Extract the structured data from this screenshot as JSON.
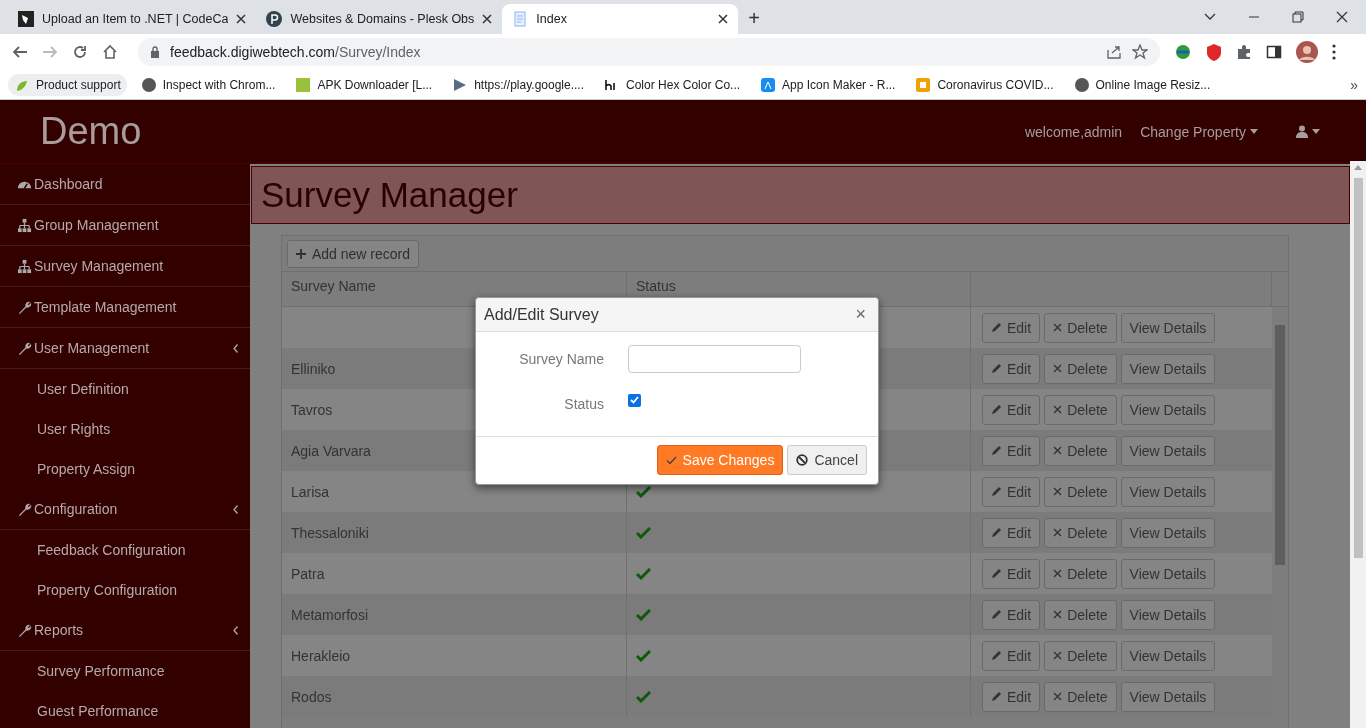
{
  "browser": {
    "tabs": [
      {
        "title": "Upload an Item to .NET | CodeCa",
        "selected": false
      },
      {
        "title": "Websites & Domains - Plesk Obs",
        "selected": false
      },
      {
        "title": "Index",
        "selected": true
      }
    ],
    "new_tab": "+",
    "url_host": "feedback.digiwebtech.com",
    "url_path": "/Survey/Index",
    "bookmarks": [
      "Product support",
      "Inspect with Chrom...",
      "APK Downloader [L...",
      "https://play.google....",
      "Color Hex Color Co...",
      "App Icon Maker - R...",
      "Coronavirus COVID...",
      "Online Image Resiz..."
    ],
    "more_bookmarks": "»"
  },
  "header": {
    "brand": "Demo",
    "welcome": "welcome,admin",
    "change_property": "Change Property"
  },
  "sidebar": {
    "items": [
      {
        "label": "Dashboard",
        "kind": "link"
      },
      {
        "label": "Group Management",
        "kind": "link"
      },
      {
        "label": "Survey Management",
        "kind": "link"
      },
      {
        "label": "Template Management",
        "kind": "link"
      },
      {
        "label": "User Management",
        "kind": "menu",
        "children": [
          {
            "label": "User Definition"
          },
          {
            "label": "User Rights"
          },
          {
            "label": "Property Assign"
          }
        ]
      },
      {
        "label": "Configuration",
        "kind": "menu",
        "children": [
          {
            "label": "Feedback Configuration"
          },
          {
            "label": "Property Configuration"
          }
        ]
      },
      {
        "label": "Reports",
        "kind": "menu",
        "children": [
          {
            "label": "Survey Performance"
          },
          {
            "label": "Guest Performance"
          }
        ]
      }
    ]
  },
  "page": {
    "title": "Survey Manager",
    "add_button": "Add new record",
    "columns": [
      "Survey Name",
      "Status"
    ],
    "rows": [
      {
        "actions": [
          "Edit",
          "Delete",
          "View Details"
        ]
      },
      {
        "name": "Elliniko",
        "actions": [
          "Edit",
          "Delete",
          "View Details"
        ]
      },
      {
        "name": "Tavros",
        "actions": [
          "Edit",
          "Delete",
          "View Details"
        ]
      },
      {
        "name": "Agia Varvara",
        "actions": [
          "Edit",
          "Delete",
          "View Details"
        ]
      },
      {
        "name": "Larisa",
        "status": true,
        "actions": [
          "Edit",
          "Delete",
          "View Details"
        ]
      },
      {
        "name": "Thessaloniki",
        "status": true,
        "actions": [
          "Edit",
          "Delete",
          "View Details"
        ]
      },
      {
        "name": "Patra",
        "status": true,
        "actions": [
          "Edit",
          "Delete",
          "View Details"
        ]
      },
      {
        "name": "Metamorfosi",
        "status": true,
        "actions": [
          "Edit",
          "Delete",
          "View Details"
        ]
      },
      {
        "name": "Herakleio",
        "status": true,
        "actions": [
          "Edit",
          "Delete",
          "View Details"
        ]
      },
      {
        "name": "Rodos",
        "status": true,
        "actions": [
          "Edit",
          "Delete",
          "View Details"
        ]
      }
    ]
  },
  "modal": {
    "title": "Add/Edit Survey",
    "close": "×",
    "fields": [
      {
        "label": "Survey Name",
        "kind": "text"
      },
      {
        "label": "Status",
        "kind": "checkbox",
        "checked": true
      }
    ],
    "buttons": [
      {
        "label": "Save Changes",
        "kind": "primary"
      },
      {
        "label": "Cancel",
        "kind": "default"
      }
    ]
  }
}
